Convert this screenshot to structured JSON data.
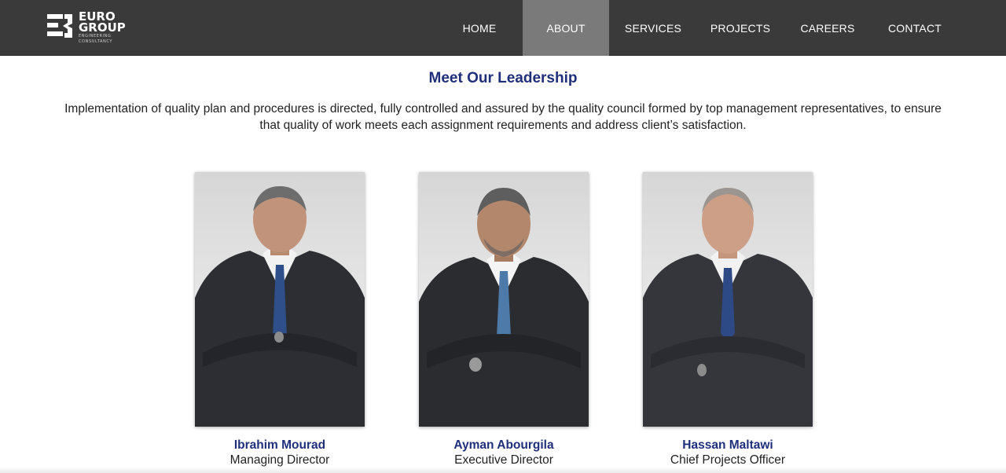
{
  "brand": {
    "line1": "EURO",
    "line2": "GROUP",
    "sub1": "ENGINEERING",
    "sub2": "CONSULTANCY",
    "colors": {
      "navbar": "#3a3a3a",
      "active_tab": "#7a7a7a",
      "heading": "#1f2f7a"
    }
  },
  "nav": {
    "items": [
      {
        "label": "HOME",
        "active": false
      },
      {
        "label": "ABOUT",
        "active": true
      },
      {
        "label": "SERVICES",
        "active": false
      },
      {
        "label": "PROJECTS",
        "active": false
      },
      {
        "label": "CAREERS",
        "active": false
      },
      {
        "label": "CONTACT",
        "active": false
      }
    ]
  },
  "section": {
    "title": "Meet Our Leadership",
    "intro": "Implementation of quality plan and procedures is directed, fully controlled and assured by the quality council formed by top management representatives, to ensure that quality of work meets each assignment requirements and address client’s satisfaction."
  },
  "leaders": [
    {
      "name": "Ibrahim Mourad",
      "role": "Managing Director",
      "photo": "portrait-photo"
    },
    {
      "name": "Ayman Abourgila",
      "role": "Executive Director",
      "photo": "portrait-photo"
    },
    {
      "name": "Hassan Maltawi",
      "role": "Chief Projects Officer",
      "photo": "portrait-photo"
    }
  ]
}
